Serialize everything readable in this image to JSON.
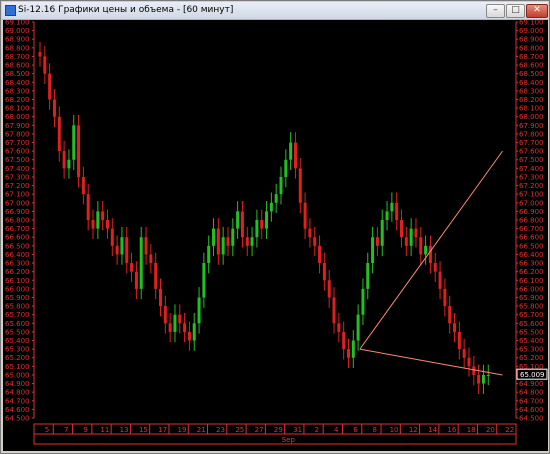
{
  "window": {
    "title": "Si-12.16 Графики цены и объема - [60 минут]",
    "buttons": {
      "minimize": "–",
      "maximize": "□",
      "close": "✕"
    }
  },
  "colors": {
    "background": "#000000",
    "axis": "#e03030",
    "grid_text": "#e03030",
    "candle_up": "#22c022",
    "candle_down": "#e02020",
    "trendline": "#ff8a70"
  },
  "chart_data": {
    "type": "candlestick",
    "y_axis_ticks": [
      "69.100",
      "69.000",
      "68.900",
      "68.800",
      "68.700",
      "68.600",
      "68.500",
      "68.400",
      "68.300",
      "68.200",
      "68.100",
      "68.000",
      "67.900",
      "67.800",
      "67.700",
      "67.600",
      "67.500",
      "67.400",
      "67.300",
      "67.200",
      "67.100",
      "67.000",
      "66.900",
      "66.800",
      "66.700",
      "66.600",
      "66.500",
      "66.400",
      "66.300",
      "66.200",
      "66.100",
      "66.000",
      "65.900",
      "65.800",
      "65.700",
      "65.600",
      "65.500",
      "65.400",
      "65.300",
      "65.200",
      "65.100",
      "65.000",
      "64.900",
      "64.800",
      "64.700",
      "64.600",
      "64.500"
    ],
    "ylim": [
      64.5,
      69.1
    ],
    "x_axis_ticks": [
      "5",
      "7",
      "9",
      "11",
      "13",
      "15",
      "17",
      "19",
      "21",
      "23",
      "25",
      "27",
      "29",
      "31",
      "2",
      "4",
      "6",
      "8",
      "10",
      "12",
      "14",
      "16",
      "18",
      "20",
      "22"
    ],
    "x_month_label": "Sep",
    "last_price_label": "65.009",
    "series": [
      {
        "name": "",
        "x": [
          0,
          0.25,
          0.5,
          0.75,
          1,
          1.25,
          1.5,
          1.75,
          2,
          2.25,
          2.5,
          2.75,
          3,
          3.25,
          3.5,
          3.75,
          4,
          4.25,
          4.5,
          4.75,
          5,
          5.25,
          5.5,
          5.75,
          6,
          6.25,
          6.5,
          6.75,
          7,
          7.25,
          7.5,
          7.75,
          8,
          8.25,
          8.5,
          8.75,
          9,
          9.25,
          9.5,
          9.75,
          10,
          10.25,
          10.5,
          10.75,
          11,
          11.25,
          11.5,
          11.75,
          12,
          12.25,
          12.5,
          12.75,
          13,
          13.25,
          13.5,
          13.75,
          14,
          14.25,
          14.5,
          14.75,
          15,
          15.25,
          15.5,
          15.75,
          16,
          16.25,
          16.5,
          16.75,
          17,
          17.25,
          17.5,
          17.75,
          18,
          18.25,
          18.5,
          18.75,
          19,
          19.25,
          19.5,
          19.75,
          20,
          20.25,
          20.5,
          20.75,
          21,
          21.25,
          21.5,
          21.75,
          22,
          22.25,
          22.5,
          22.75,
          23,
          23.25,
          23.5,
          23.75,
          24,
          24.25
        ],
        "close": [
          68.7,
          68.5,
          68.2,
          68.0,
          67.6,
          67.4,
          67.5,
          67.9,
          67.3,
          67.1,
          66.8,
          66.7,
          66.9,
          66.8,
          66.7,
          66.5,
          66.4,
          66.6,
          66.3,
          66.2,
          66.0,
          66.6,
          66.4,
          66.3,
          66.0,
          65.8,
          65.6,
          65.5,
          65.7,
          65.6,
          65.5,
          65.4,
          65.6,
          65.9,
          66.3,
          66.5,
          66.7,
          66.4,
          66.6,
          66.5,
          66.7,
          66.9,
          66.6,
          66.5,
          66.6,
          66.8,
          66.7,
          66.9,
          67.0,
          67.1,
          67.3,
          67.5,
          67.7,
          67.4,
          67.0,
          66.7,
          66.6,
          66.5,
          66.3,
          66.1,
          65.9,
          65.6,
          65.5,
          65.3,
          65.2,
          65.4,
          65.7,
          66.0,
          66.3,
          66.6,
          66.5,
          66.8,
          66.9,
          67.0,
          66.8,
          66.6,
          66.5,
          66.7,
          66.6,
          66.4,
          66.5,
          66.3,
          66.2,
          66.0,
          65.8,
          65.6,
          65.5,
          65.3,
          65.2,
          65.1,
          65.0,
          64.9,
          65.0,
          65.0
        ]
      }
    ],
    "trendlines": [
      {
        "from": [
          16.9,
          65.3
        ],
        "to": [
          24.3,
          67.6
        ]
      },
      {
        "from": [
          16.9,
          65.3
        ],
        "to": [
          24.3,
          65.0
        ]
      }
    ]
  }
}
